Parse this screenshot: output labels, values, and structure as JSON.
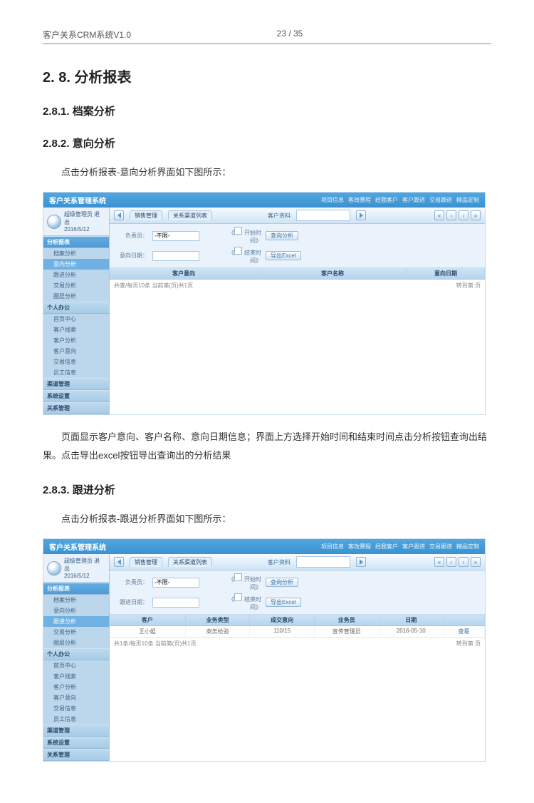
{
  "header": {
    "title": "客户关系CRM系统V1.0",
    "page_num": "23 / 35"
  },
  "sec28": {
    "number": "2. 8.",
    "title": "分析报表"
  },
  "sec281": {
    "number": "2.8.1.",
    "title": "档案分析"
  },
  "sec282": {
    "number": "2.8.2.",
    "title": "意向分析"
  },
  "sec283": {
    "number": "2.8.3.",
    "title": "跟进分析"
  },
  "para282a": "点击分析报表-意向分析界面如下图所示：",
  "para282b": "页面显示客户意向、客户名称、意向日期信息；界面上方选择开始时间和结束时间点击分析按钮查询出结果。点击导出excel按钮导出查询出的分析结果",
  "para283a": "点击分析报表-跟进分析界面如下图所示：",
  "crm": {
    "app_title": "客户关系管理系统",
    "top_links": [
      "项目信息",
      "客改赛程",
      "经我客户",
      "客户跟进",
      "交易跟进",
      "精品定制"
    ],
    "user_role": "超级管理员",
    "signout": "退出",
    "date": "2016/5/12",
    "side": {
      "sec_analysis": "分析报表",
      "items_analysis": [
        "档案分析",
        "意向分析",
        "跟进分析",
        "交易分析",
        "圈层分析"
      ],
      "sec_personal": "个人办公",
      "items_personal": [
        "首页中心",
        "客户线索",
        "客户分析",
        "客户意向",
        "交易信息",
        "员工信息"
      ],
      "sec_channel": "渠道管理",
      "sec_sys": "系统设置",
      "sec_group": "关系管理"
    },
    "toolbar": {
      "tab1": "销售管理",
      "tab2": "关系渠道列表",
      "search_label": "客户资料"
    },
    "filter": {
      "belong_label": "负责员：",
      "belong_value": "-不限-",
      "startend_label": "意向日期：",
      "track_label": "跟进日期：",
      "timerange_chk": "开始时间",
      "endrange_chk": "结束时间",
      "btn_query": "查询分析",
      "btn_export": "导出Excel"
    },
    "table282": {
      "cols": [
        "客户意向",
        "客户名称",
        "意向日期"
      ],
      "footer_left": "共查/每页10条 当前第(页)共1页",
      "footer_right": "转到第   页"
    },
    "table283": {
      "cols": [
        "客户",
        "业务类型",
        "成交意向",
        "业务员",
        "日期",
        ""
      ],
      "row": [
        "王小姐",
        "商务检验",
        "110/15",
        "宣传管理员",
        "2016-05-10",
        "查看"
      ],
      "footer_left": "共1条/每页10条 当前第(页)共1页",
      "footer_right": "转到第   页"
    }
  }
}
